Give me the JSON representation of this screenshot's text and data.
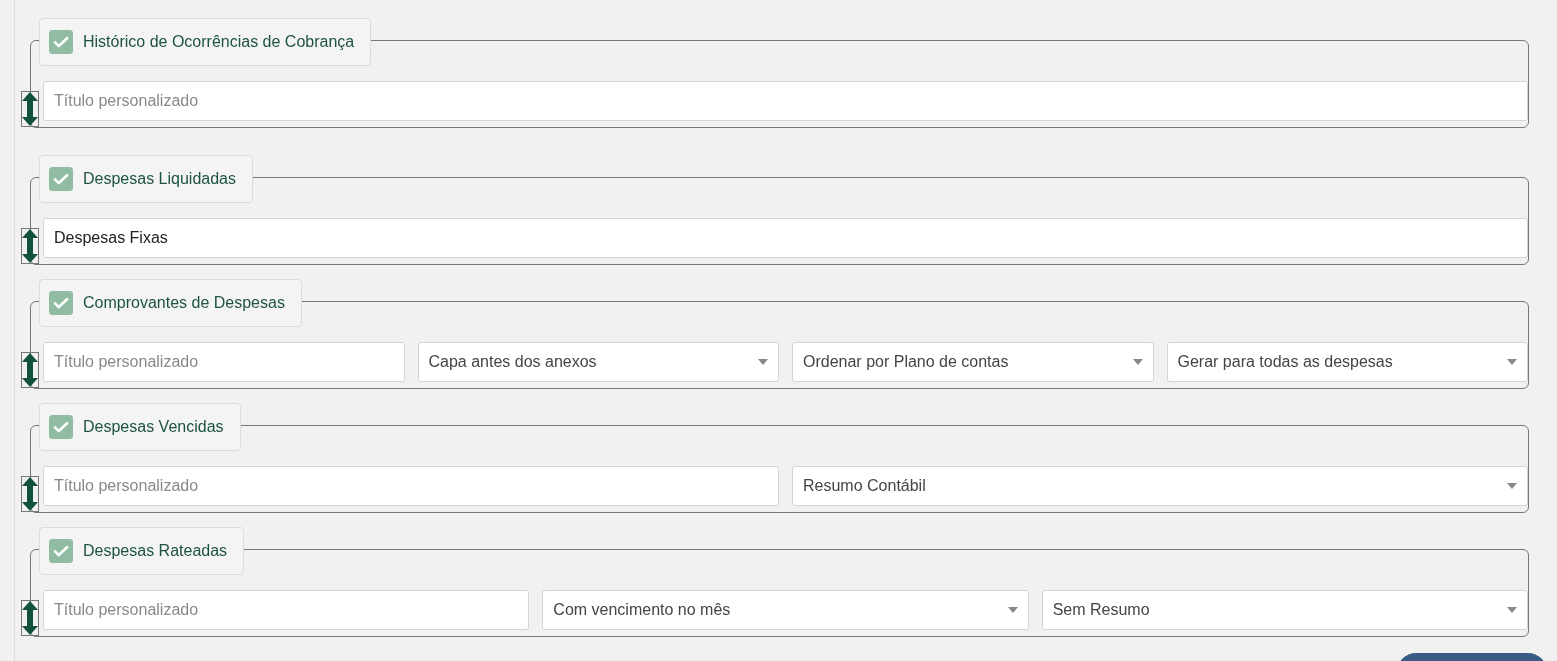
{
  "sections": [
    {
      "title": "Histórico de Ocorrências de Cobrança",
      "checked": true,
      "fields": [
        {
          "kind": "text",
          "placeholder": "Título personalizado"
        }
      ]
    },
    {
      "title": "Despesas Liquidadas",
      "checked": true,
      "fields": [
        {
          "kind": "text",
          "value": "Despesas Fixas"
        }
      ]
    },
    {
      "title": "Comprovantes de Despesas",
      "checked": true,
      "fields": [
        {
          "kind": "text",
          "placeholder": "Título personalizado"
        },
        {
          "kind": "select",
          "value": "Capa antes dos anexos"
        },
        {
          "kind": "select",
          "value": "Ordenar por Plano de contas"
        },
        {
          "kind": "select",
          "value": "Gerar para todas as despesas"
        }
      ]
    },
    {
      "title": "Despesas Vencidas",
      "checked": true,
      "fields": [
        {
          "kind": "text",
          "placeholder": "Título personalizado"
        },
        {
          "kind": "select",
          "value": "Resumo Contábil"
        }
      ]
    },
    {
      "title": "Despesas Rateadas",
      "checked": true,
      "fields": [
        {
          "kind": "text",
          "placeholder": "Título personalizado"
        },
        {
          "kind": "select",
          "value": "Com vencimento no mês"
        },
        {
          "kind": "select",
          "value": "Sem Resumo"
        }
      ]
    }
  ]
}
